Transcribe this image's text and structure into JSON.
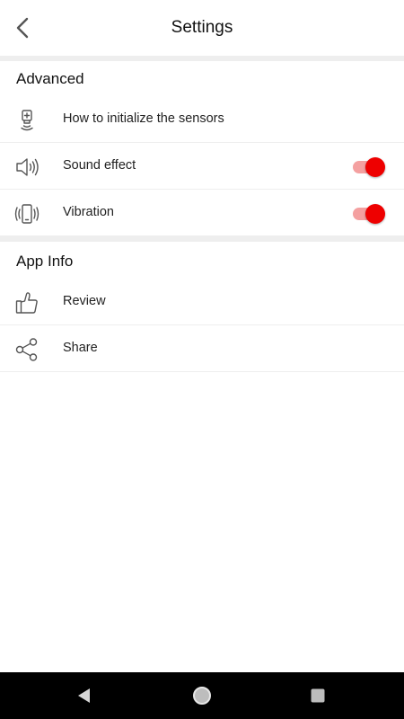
{
  "header": {
    "title": "Settings",
    "back_icon": "chevron-left-icon"
  },
  "sections": [
    {
      "title": "Advanced",
      "items": [
        {
          "label": "How to initialize the sensors",
          "icon": "sensor-icon"
        },
        {
          "label": "Sound effect",
          "icon": "speaker-icon",
          "toggle": true
        },
        {
          "label": "Vibration",
          "icon": "vibration-icon",
          "toggle": true
        }
      ]
    },
    {
      "title": "App Info",
      "items": [
        {
          "label": "Review",
          "icon": "thumbs-up-icon"
        },
        {
          "label": "Share",
          "icon": "share-icon"
        }
      ]
    }
  ],
  "colors": {
    "accent": "#ee0000",
    "toggle_track": "#f4a0a0",
    "divider": "#eeeeee"
  },
  "system_nav": {
    "buttons": [
      "back-triangle-icon",
      "home-circle-icon",
      "recents-square-icon"
    ]
  }
}
